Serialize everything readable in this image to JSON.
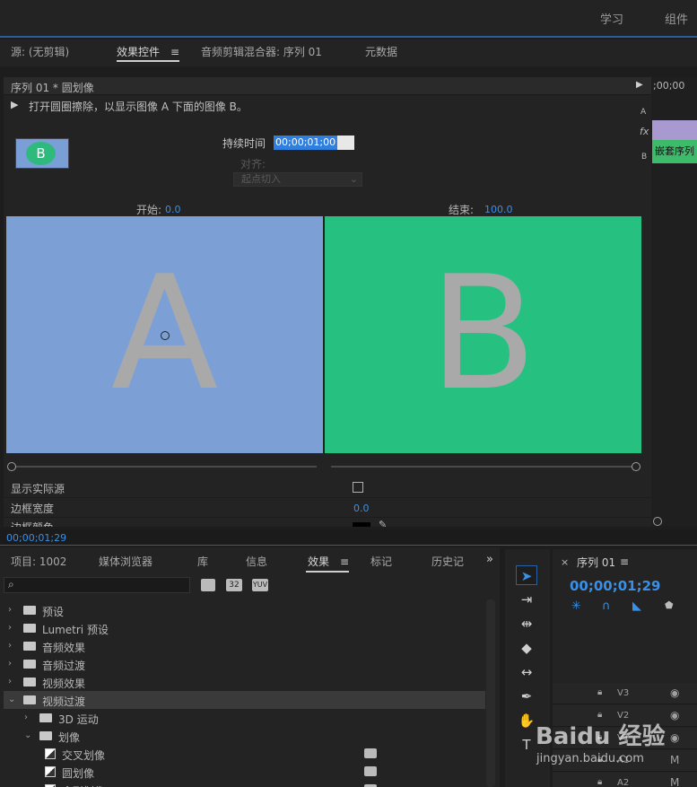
{
  "workspace": {
    "items": [
      "学习",
      "组件"
    ]
  },
  "top_tabs": [
    "源: (无剪辑)",
    "效果控件",
    "音频剪辑混合器: 序列 01",
    "元数据"
  ],
  "effect_controls": {
    "sequence_title": "序列 01 * 圆划像",
    "description": "打开圆圈擦除，以显示图像 A 下面的图像 B。",
    "thumbnail_letter": "B",
    "duration_label": "持续时间",
    "duration_value": "00;00;01;00",
    "align_label": "对齐:",
    "align_value": "起点切入",
    "start_label": "开始:",
    "start_value": "0.0",
    "end_label": "结束:",
    "end_value": "100.0",
    "image_a_letter": "A",
    "image_b_letter": "B",
    "props": [
      "显示实际源",
      "边框宽度",
      "边框颜色"
    ],
    "border_width_value": "0.0",
    "side_letters": [
      "A",
      "fx",
      "B"
    ],
    "timeline_time": ";00;00",
    "clip_label": "嵌套序列"
  },
  "timecode": "00;00;01;29",
  "bottom_tabs": [
    "项目: 1002",
    "媒体浏览器",
    "库",
    "信息",
    "效果",
    "标记",
    "历史记"
  ],
  "effects_tree": [
    {
      "label": "预设",
      "level": 0,
      "open": false
    },
    {
      "label": "Lumetri 预设",
      "level": 0,
      "open": false
    },
    {
      "label": "音频效果",
      "level": 0,
      "open": false
    },
    {
      "label": "音频过渡",
      "level": 0,
      "open": false
    },
    {
      "label": "视频效果",
      "level": 0,
      "open": false
    },
    {
      "label": "视频过渡",
      "level": 0,
      "open": true
    },
    {
      "label": "3D 运动",
      "level": 1,
      "open": false
    },
    {
      "label": "划像",
      "level": 1,
      "open": true
    },
    {
      "label": "交叉划像",
      "level": 2
    },
    {
      "label": "圆划像",
      "level": 2
    },
    {
      "label": "盒形划像",
      "level": 2
    }
  ],
  "sequence_panel": {
    "name": "序列 01",
    "timecode": "00;00;01;29",
    "tracks": [
      "V3",
      "V2",
      "V1",
      "A1",
      "A2"
    ]
  },
  "watermark": {
    "brand": "Baidu 经验",
    "url": "jingyan.baidu.com"
  }
}
